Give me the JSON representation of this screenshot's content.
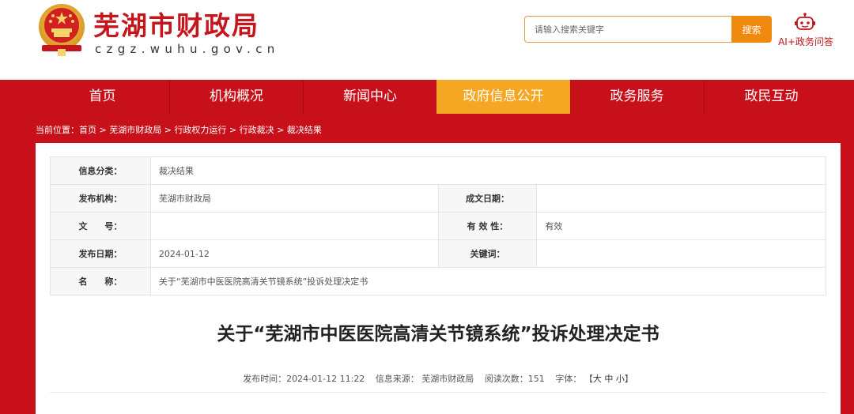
{
  "header": {
    "site_name": "芜湖市财政局",
    "site_domain": "czgz.wuhu.gov.cn",
    "search_placeholder": "请输入搜索关键字",
    "search_button": "搜索",
    "ai_label": "AI+政务问答",
    "emblem_icon": "national-emblem-icon",
    "ai_icon": "robot-icon"
  },
  "nav": {
    "items": [
      {
        "label": "首页"
      },
      {
        "label": "机构概况"
      },
      {
        "label": "新闻中心"
      },
      {
        "label": "政府信息公开"
      },
      {
        "label": "政务服务"
      },
      {
        "label": "政民互动"
      }
    ],
    "active_index": 3
  },
  "breadcrumb": {
    "prefix": "当前位置：",
    "items": [
      "首页",
      "芜湖市财政局",
      "行政权力运行",
      "行政裁决",
      "裁决结果"
    ],
    "separator": " > "
  },
  "info": {
    "category_label": "信息分类：",
    "category_value": "裁决结果",
    "publisher_label": "发布机构：",
    "publisher_value": "芜湖市财政局",
    "created_label": "成文日期：",
    "created_value": "",
    "docno_label": "文　　号：",
    "docno_value": "",
    "validity_label": "有 效 性：",
    "validity_value": "有效",
    "pubdate_label": "发布日期：",
    "pubdate_value": "2024-01-12",
    "keywords_label": "关键词：",
    "keywords_value": "",
    "name_label": "名　　称：",
    "name_value": "关于“芜湖市中医医院高清关节镜系统”投诉处理决定书"
  },
  "article": {
    "title": "关于“芜湖市中医医院高清关节镜系统”投诉处理决定书",
    "meta": {
      "pubtime": "发布时间：2024-01-12 11:22",
      "source": "信息来源：  芜湖市财政局",
      "views": "阅读次数：151",
      "font_label": "字体：",
      "font_open": "【",
      "font_large": "大",
      "font_medium": "中",
      "font_small": "小",
      "font_close": "】"
    }
  },
  "colors": {
    "brand_red": "#c8101a",
    "active_orange": "#f5a623",
    "search_orange": "#f08a0e"
  }
}
